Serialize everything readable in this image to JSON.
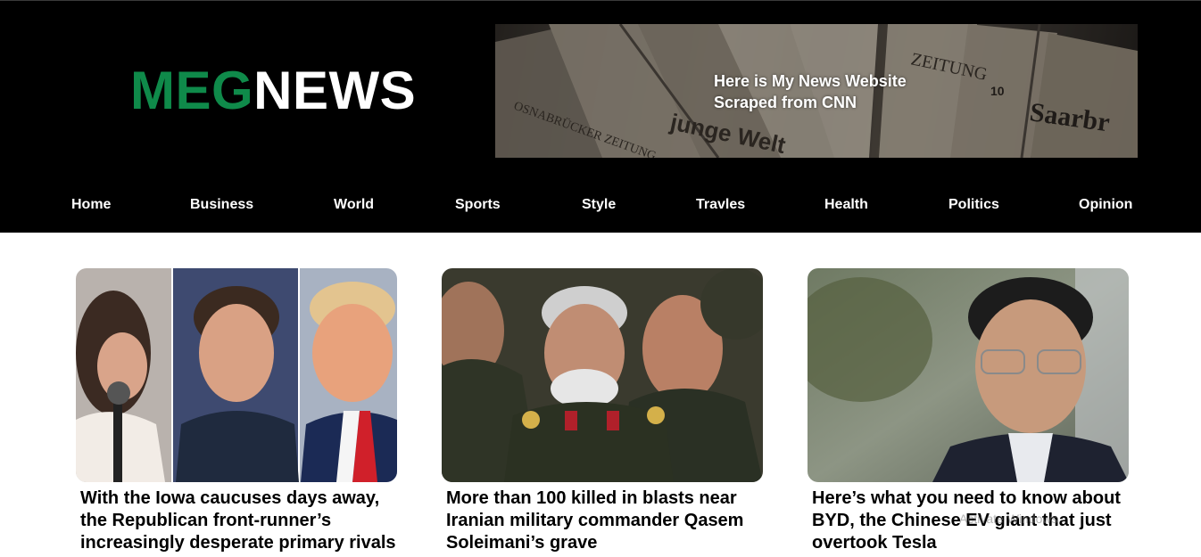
{
  "logo": {
    "part1": "MEG",
    "part2": "NEWS"
  },
  "banner": {
    "line1": "Here is My News Website",
    "line2": "Scraped from CNN",
    "newspaper_words": [
      "ZEITUNG",
      "OSNABRÜCKER ZEITUNG",
      "junge Welt",
      "Saarbr",
      "10"
    ]
  },
  "nav": {
    "items": [
      {
        "label": "Home"
      },
      {
        "label": "Business"
      },
      {
        "label": "World"
      },
      {
        "label": "Sports"
      },
      {
        "label": "Style"
      },
      {
        "label": "Travles"
      },
      {
        "label": "Health"
      },
      {
        "label": "Politics"
      },
      {
        "label": "Opinion"
      }
    ]
  },
  "articles": [
    {
      "title": "With the Iowa caucuses days away, the Republican front-runner’s increasingly desperate primary rivals",
      "image": "three-candidates-photo"
    },
    {
      "title": "More than 100 killed in blasts near Iranian military commander Qasem Soleimani’s grave",
      "image": "military-commander-photo"
    },
    {
      "title": "Here’s what you need to know about BYD, the Chinese EV giant that just overtook Tesla",
      "image": "byd-executive-photo"
    }
  ],
  "watermark": {
    "text": "Activate Windows"
  },
  "colors": {
    "accent": "#0f8a4a",
    "header_bg": "#000000",
    "text": "#000000"
  }
}
